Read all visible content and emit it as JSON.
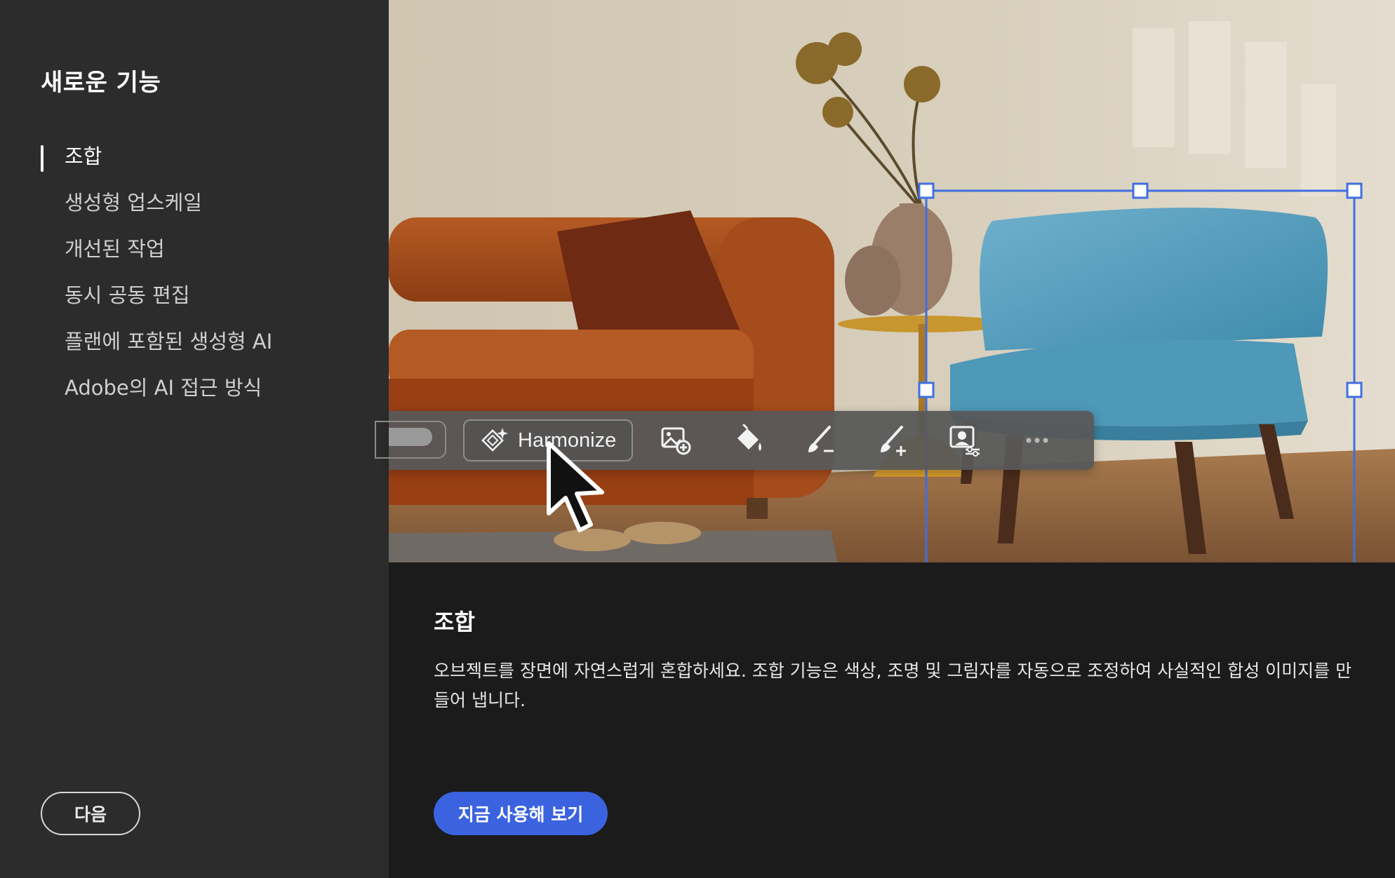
{
  "sidebar": {
    "title": "새로운 기능",
    "items": [
      {
        "label": "조합",
        "active": true
      },
      {
        "label": "생성형 업스케일",
        "active": false
      },
      {
        "label": "개선된 작업",
        "active": false
      },
      {
        "label": "동시 공동 편집",
        "active": false
      },
      {
        "label": "플랜에 포함된 생성형 AI",
        "active": false
      },
      {
        "label": "Adobe의 AI 접근 방식",
        "active": false
      }
    ],
    "next_label": "다음"
  },
  "toolbar": {
    "harmonize_label": "Harmonize",
    "icons": [
      "sparkle-harmonize-icon",
      "image-add-icon",
      "paint-bucket-icon",
      "brush-subtract-icon",
      "brush-add-icon",
      "mask-adjust-icon",
      "more-icon"
    ]
  },
  "content": {
    "title": "조합",
    "description": "오브젝트를 장면에 자연스럽게 혼합하세요. 조합 기능은 색상, 조명 및 그림자를 자동으로 조정하여 사실적인 합성 이미지를 만들어 냅니다.",
    "cta_label": "지금 사용해 보기"
  },
  "colors": {
    "sidebar_bg": "#2c2c2c",
    "content_bg": "#1b1b1b",
    "accent": "#3b63e0",
    "selection": "#3f6fe0"
  }
}
